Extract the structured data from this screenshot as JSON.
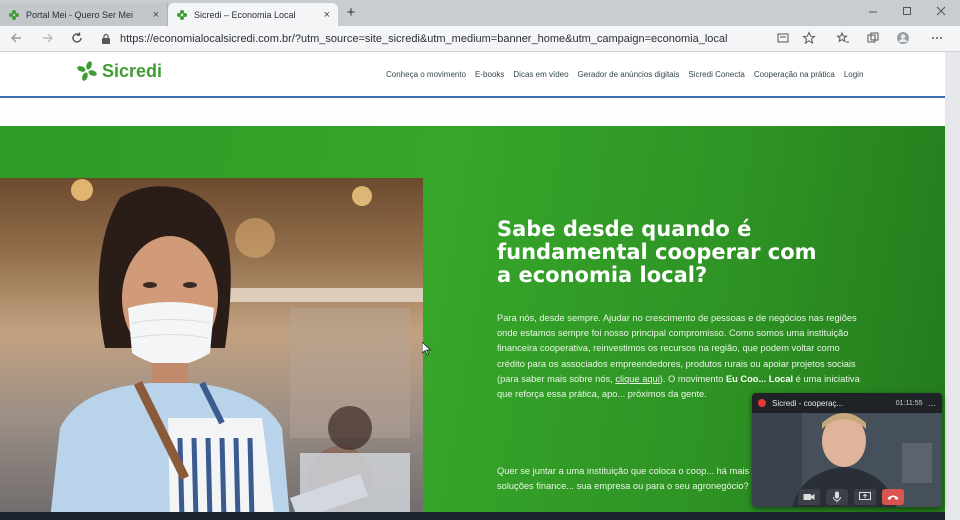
{
  "browser": {
    "tabs": [
      {
        "label": "Portal Mei - Quero Ser Mei",
        "close": "×"
      },
      {
        "label": "Sicredi – Economia Local",
        "close": "×"
      }
    ],
    "new_tab": "+",
    "url": "https://economialocalsicredi.com.br/?utm_source=site_sicredi&utm_medium=banner_home&utm_campaign=economia_local"
  },
  "site": {
    "logo_text": "Sicredi",
    "nav": [
      "Conheça o movimento",
      "E-books",
      "Dicas em vídeo",
      "Gerador de anúncios digitais",
      "Sicredi Conecta",
      "Cooperação na prática",
      "Login"
    ]
  },
  "hero": {
    "title": "Sabe desde quando é fundamental cooperar com a economia local?",
    "body_1": "Para nós, desde sempre. Ajudar no crescimento de pessoas e de negócios nas regiões onde estamos sempre foi nosso principal compromisso. Como somos uma instituição financeira cooperativa, reinvestimos os recursos na região, que podem voltar como crédito para os associados empreendedores, produtos rurais ou apoiar projetos sociais (para saber mais sobre nós, ",
    "body_link": "clique aqui",
    "body_2": "). O movimento ",
    "body_bold": "Eu Coo... Local",
    "body_3": " é uma iniciativa que reforça essa prática, apo... próximos da gente.",
    "cta": "Quer se juntar a uma instituição que coloca o coop... há mais de 117 anos por meio de soluções finance... sua empresa ou para o seu agronegócio?"
  },
  "call": {
    "title": "Sicredi - cooperaç...",
    "timer": "01:11:55",
    "more": "..."
  },
  "colors": {
    "brand_green": "#3f9c35",
    "hero_green": "#36a62a",
    "hangup_red": "#d9534f"
  }
}
